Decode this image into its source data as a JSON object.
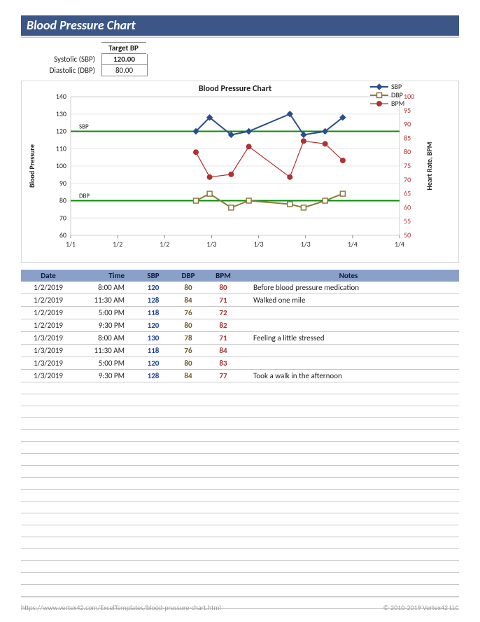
{
  "header": {
    "title": "Blood Pressure Chart"
  },
  "target": {
    "header_label": "Target BP",
    "sbp_label": "Systolic (SBP)",
    "dbp_label": "Diastolic (DBP)",
    "sbp_value": "120.00",
    "dbp_value": "80.00"
  },
  "footer": {
    "url": "https://www.vertex42.com/ExcelTemplates/blood-pressure-chart.html",
    "copyright": "© 2010-2019 Vertex42 LLC"
  },
  "table": {
    "headers": {
      "date": "Date",
      "time": "Time",
      "sbp": "SBP",
      "dbp": "DBP",
      "bpm": "BPM",
      "notes": "Notes"
    },
    "rows": [
      {
        "date": "1/2/2019",
        "time": "8:00 AM",
        "sbp": "120",
        "dbp": "80",
        "bpm": "80",
        "notes": "Before blood pressure medication"
      },
      {
        "date": "1/2/2019",
        "time": "11:30 AM",
        "sbp": "128",
        "dbp": "84",
        "bpm": "71",
        "notes": "Walked one mile"
      },
      {
        "date": "1/2/2019",
        "time": "5:00 PM",
        "sbp": "118",
        "dbp": "76",
        "bpm": "72",
        "notes": ""
      },
      {
        "date": "1/2/2019",
        "time": "9:30 PM",
        "sbp": "120",
        "dbp": "80",
        "bpm": "82",
        "notes": ""
      },
      {
        "date": "1/3/2019",
        "time": "8:00 AM",
        "sbp": "130",
        "dbp": "78",
        "bpm": "71",
        "notes": "Feeling a little stressed"
      },
      {
        "date": "1/3/2019",
        "time": "11:30 AM",
        "sbp": "118",
        "dbp": "76",
        "bpm": "84",
        "notes": ""
      },
      {
        "date": "1/3/2019",
        "time": "5:00 PM",
        "sbp": "120",
        "dbp": "80",
        "bpm": "83",
        "notes": ""
      },
      {
        "date": "1/3/2019",
        "time": "9:30 PM",
        "sbp": "128",
        "dbp": "84",
        "bpm": "77",
        "notes": "Took a walk in the afternoon"
      }
    ],
    "blank_row_count": 19
  },
  "chart_data": {
    "type": "line",
    "title": "Blood Pressure Chart",
    "x": [
      1.333,
      1.479,
      1.708,
      1.896,
      2.333,
      2.479,
      2.708,
      2.896
    ],
    "x_ticks": [
      0,
      0.5,
      1.0,
      1.5,
      2.0,
      2.5,
      3.0,
      3.5
    ],
    "x_tick_labels": [
      "1/1",
      "1/2",
      "1/2",
      "1/3",
      "1/3",
      "1/3",
      "1/4",
      "1/4"
    ],
    "y_left": {
      "label": "Blood Pressure",
      "min": 60,
      "max": 140,
      "ticks": [
        60,
        70,
        80,
        90,
        100,
        110,
        120,
        130,
        140
      ]
    },
    "y_right": {
      "label": "Heart Rate, BPM",
      "min": 50,
      "max": 100,
      "ticks": [
        50,
        55,
        60,
        65,
        70,
        75,
        80,
        85,
        90,
        95,
        100
      ],
      "color": "#b03232"
    },
    "legend": [
      "SBP",
      "DBP",
      "BPM"
    ],
    "series": [
      {
        "name": "SBP",
        "axis": "left",
        "color": "#2a4d8f",
        "marker": "diamond",
        "values": [
          120,
          128,
          118,
          120,
          130,
          118,
          120,
          128
        ]
      },
      {
        "name": "DBP",
        "axis": "left",
        "color": "#8a7a3a",
        "marker": "square",
        "values": [
          80,
          84,
          76,
          80,
          78,
          76,
          80,
          84
        ]
      },
      {
        "name": "BPM",
        "axis": "right",
        "color": "#b03232",
        "marker": "circle",
        "values": [
          80,
          71,
          72,
          82,
          71,
          84,
          83,
          77
        ]
      }
    ],
    "ref_lines": [
      {
        "label": "SBP",
        "axis": "left",
        "value": 120,
        "color": "#0a8a0a"
      },
      {
        "label": "DBP",
        "axis": "left",
        "value": 80,
        "color": "#0a8a0a"
      }
    ]
  }
}
